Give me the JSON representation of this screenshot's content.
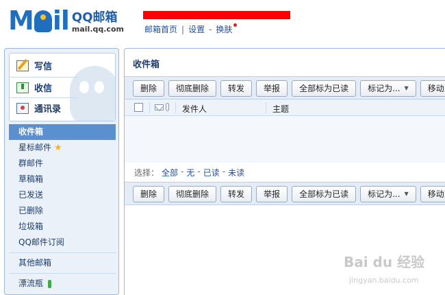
{
  "header": {
    "logo_main": "MOil",
    "logo_brand": "QQ邮箱",
    "logo_domain": "mail.qq.com",
    "links": {
      "home": "邮箱首页",
      "settings": "设置",
      "dash": "-",
      "skin": "换肤"
    }
  },
  "sidebar": {
    "actions": [
      {
        "label": "写信",
        "icon": "write-icon"
      },
      {
        "label": "收信",
        "icon": "receive-icon"
      },
      {
        "label": "通讯录",
        "icon": "contacts-icon"
      }
    ],
    "folders": [
      {
        "label": "收件箱",
        "active": true
      },
      {
        "label": "星标邮件",
        "icon": "star-icon"
      },
      {
        "label": "群邮件"
      },
      {
        "label": "草稿箱"
      },
      {
        "label": "已发送"
      },
      {
        "label": "已删除"
      },
      {
        "label": "垃圾箱"
      },
      {
        "label": "QQ邮件订阅"
      }
    ],
    "other": "其他邮箱",
    "drift": "漂流瓶"
  },
  "main": {
    "title": "收件箱",
    "toolbar": {
      "delete": "删除",
      "perm_delete": "彻底删除",
      "forward": "转发",
      "report": "举报",
      "mark_all_read": "全部标为已读",
      "mark_as": "标记为...",
      "move_to": "移动到"
    },
    "table": {
      "col_sender": "发件人",
      "col_subject": "主题"
    },
    "select": {
      "label": "选择：",
      "all": "全部",
      "none": "无",
      "read": "已读",
      "unread": "未读",
      "dash": "-"
    }
  },
  "watermark": {
    "main": "Bai du 经验",
    "sub": "jingyan.baidu.com"
  },
  "colors": {
    "accent": "#1f6fc1",
    "active_folder": "#5a8fd0",
    "redaction": "#ff0000"
  }
}
